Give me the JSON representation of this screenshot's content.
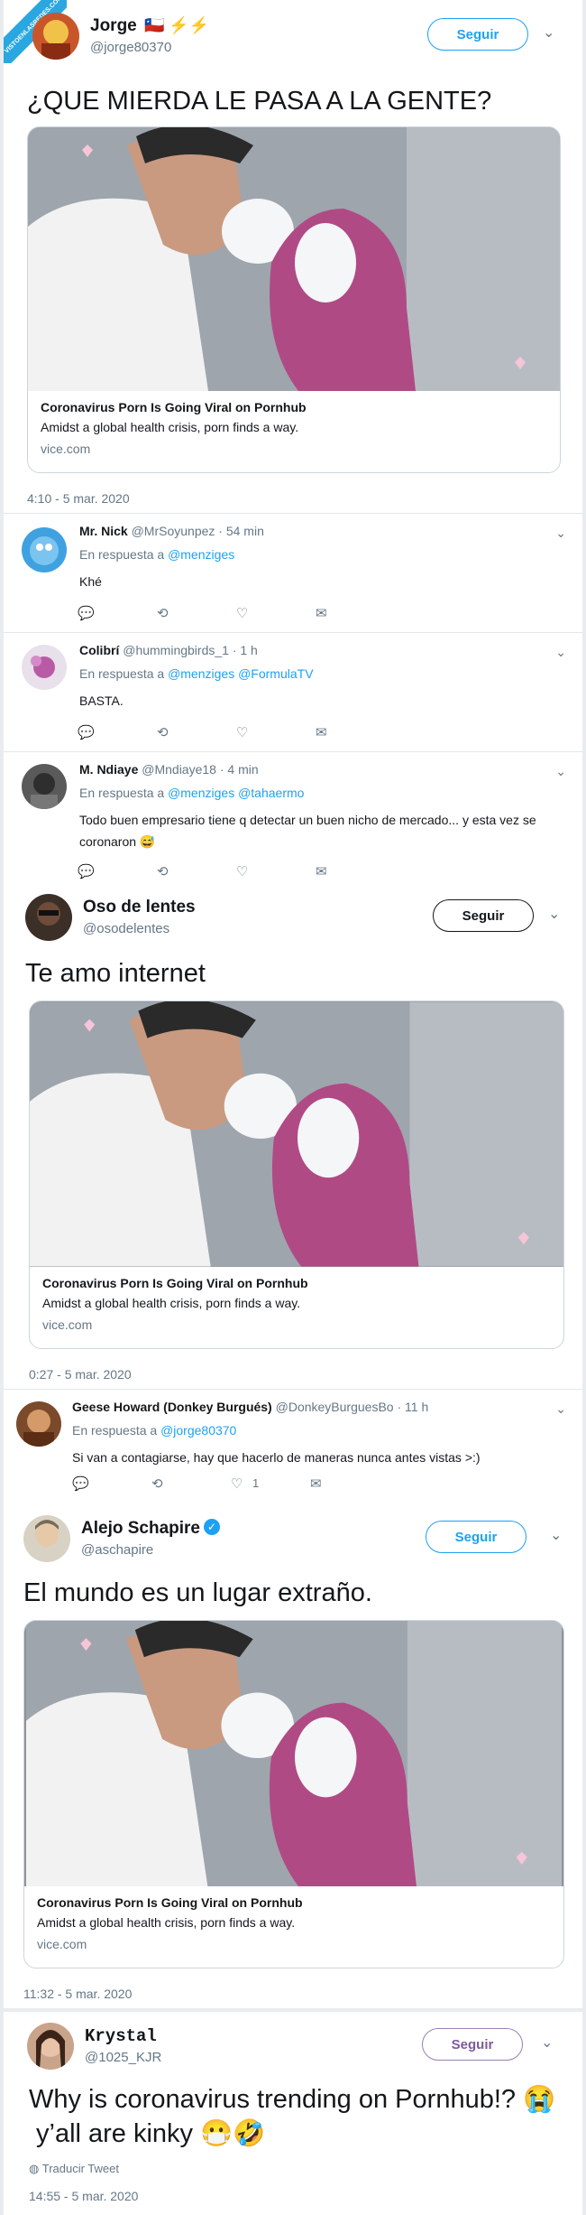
{
  "watermark": "VISTOENLASREDES.COM",
  "colors": {
    "accent": "#1da1f2",
    "muted": "#657786",
    "verified": "#1da1f2"
  },
  "t1": {
    "name": "Jorge",
    "flags": "🇨🇱 ⚡⚡",
    "handle": "@jorge80370",
    "follow": "Seguir",
    "text": "¿QUE MIERDA LE PASA A LA GENTE?",
    "card": {
      "title": "Coronavirus Porn Is Going Viral on Pornhub",
      "desc": "Amidst a global health crisis, porn finds a way.",
      "domain": "vice.com"
    },
    "time": "4:10 - 5 mar. 2020"
  },
  "replies": [
    {
      "name": "Mr. Nick",
      "handle": "@MrSoyunpez · 54 min",
      "to": "En respuesta a",
      "mentions": "@menziges",
      "text": "Khé",
      "likes": ""
    },
    {
      "name": "Colibrí",
      "handle": "@hummingbirds_1 · 1 h",
      "to": "En respuesta a",
      "mentions": "@menziges @FormulaTV",
      "text": "BASTA.",
      "likes": ""
    },
    {
      "name": "M. Ndiaye",
      "handle": "@Mndiaye18 · 4 min",
      "to": "En respuesta a",
      "mentions": "@menziges @tahaermo",
      "text": "Todo buen empresario tiene q detectar un buen nicho de mercado... y esta vez se coronaron 😅",
      "likes": ""
    }
  ],
  "t2": {
    "name": "Oso de lentes",
    "handle": "@osodelentes",
    "follow": "Seguir",
    "text": "Te amo internet",
    "card": {
      "title": "Coronavirus Porn Is Going Viral on Pornhub",
      "desc": "Amidst a global health crisis, porn finds a way.",
      "domain": "vice.com"
    },
    "time": "0:27 - 5 mar. 2020",
    "reply": {
      "name": "Geese Howard (Donkey Burgués)",
      "handle": "@DonkeyBurguesBo · 11 h",
      "to": "En respuesta a",
      "mentions": "@jorge80370",
      "text": "Si van a contagiarse, hay que hacerlo de maneras nunca antes vistas >:)",
      "likes": "1"
    }
  },
  "t3": {
    "name": "Alejo Schapire",
    "handle": "@aschapire",
    "follow": "Seguir",
    "text": "El mundo es un lugar extraño.",
    "card": {
      "title": "Coronavirus Porn Is Going Viral on Pornhub",
      "desc": "Amidst a global health crisis, porn finds a way.",
      "domain": "vice.com"
    },
    "time": "11:32 - 5 mar. 2020"
  },
  "t4": {
    "name": "Krystal",
    "handle": "@1025_KJR",
    "follow": "Seguir",
    "text1": "Why is coronavirus trending on Pornhub!? 😭",
    "text2": "y’all are kinky 😷🤣",
    "translate": "Traducir Tweet",
    "time": "14:55 - 5 mar. 2020"
  }
}
